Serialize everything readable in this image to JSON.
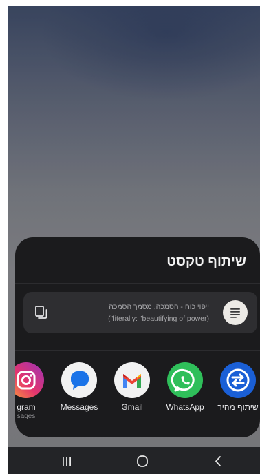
{
  "share_sheet": {
    "title": "שיתוף טקסט",
    "preview": {
      "line1": "ייפוי כוח - הסמכה, מסמך הסמכה",
      "line2": "(\"literally: \"beautifying of power)"
    },
    "apps": [
      {
        "label": "שיתוף מהיר",
        "icon": "quick-share-icon",
        "color": "#1a5fd6"
      },
      {
        "label": "WhatsApp",
        "icon": "whatsapp-icon",
        "color": "#2fbf5a"
      },
      {
        "label": "Gmail",
        "icon": "gmail-icon",
        "color": "#f2f2f2"
      },
      {
        "label": "Messages",
        "icon": "messages-icon",
        "color": "#f2f2f2"
      },
      {
        "label": "gram",
        "sublabel": "sages",
        "icon": "instagram-icon",
        "color": "#d8307a"
      }
    ]
  },
  "navigation": {
    "recents": "recents-icon",
    "home": "home-icon",
    "back": "back-icon"
  }
}
